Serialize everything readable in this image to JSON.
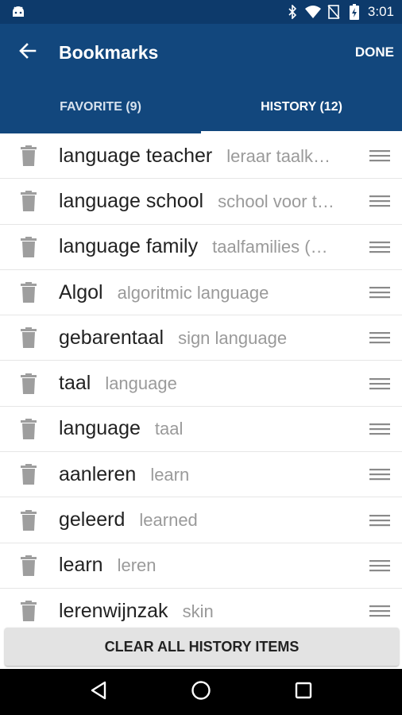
{
  "status_bar": {
    "time": "3:01",
    "icons": [
      "android-icon",
      "bluetooth-icon",
      "wifi-icon",
      "no-sim-icon",
      "battery-icon"
    ]
  },
  "toolbar": {
    "title": "Bookmarks",
    "done_label": "DONE",
    "back_icon": "arrow-left-icon"
  },
  "tabs": [
    {
      "label": "FAVORITE (9)",
      "active": false
    },
    {
      "label": "HISTORY (12)",
      "active": true
    }
  ],
  "history": [
    {
      "term": "language teacher",
      "translation": "leraar taalk…"
    },
    {
      "term": "language school",
      "translation": "school voor t…"
    },
    {
      "term": "language family",
      "translation": "taalfamilies (…"
    },
    {
      "term": "Algol",
      "translation": "algoritmic language"
    },
    {
      "term": "gebarentaal",
      "translation": "sign language"
    },
    {
      "term": "taal",
      "translation": "language"
    },
    {
      "term": "language",
      "translation": "taal"
    },
    {
      "term": "aanleren",
      "translation": "learn"
    },
    {
      "term": "geleerd",
      "translation": "learned"
    },
    {
      "term": "learn",
      "translation": "leren"
    },
    {
      "term": "lerenwijnzak",
      "translation": "skin"
    }
  ],
  "clear_button": {
    "label": "CLEAR ALL HISTORY ITEMS"
  },
  "colors": {
    "status_bar": "#0d3a6b",
    "app_bar": "#12477d",
    "term_text": "#222222",
    "translation_text": "#9a9a9a",
    "icon_gray": "#9e9e9e"
  }
}
